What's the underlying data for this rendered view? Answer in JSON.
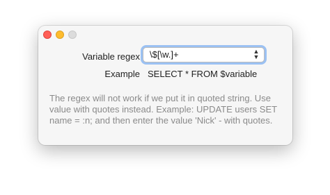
{
  "window": {
    "controls": [
      "close",
      "minimize",
      "zoom"
    ]
  },
  "form": {
    "regex_label": "Variable regex",
    "regex_value": "\\$[\\w.]+",
    "example_label": "Example",
    "example_value": "SELECT * FROM $variable"
  },
  "help_text": "The regex will not work if we put it in quoted string. Use value with quotes instead. Example: UPDATE users SET name = :n; and then enter the value 'Nick' - with quotes.",
  "icons": {
    "chevron": "up-down-chevron-icon"
  },
  "colors": {
    "close": "#ff5f57",
    "minimize": "#febc2e",
    "zoom": "#dcdcdc",
    "focus_ring": "#5096f0",
    "help_text": "#8a8a8a"
  }
}
